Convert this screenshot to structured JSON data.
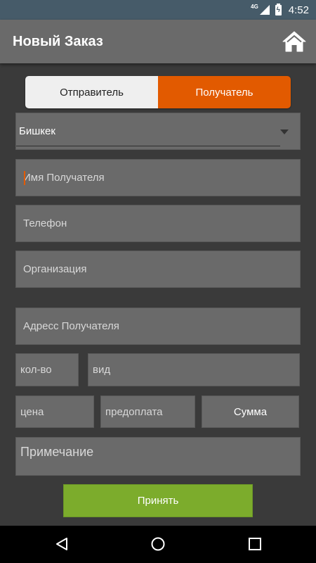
{
  "status_bar": {
    "network": "4G",
    "time": "4:52"
  },
  "app_bar": {
    "title": "Новый Заказ"
  },
  "toggle": {
    "sender_label": "Отправитель",
    "recipient_label": "Получатель",
    "active": "recipient",
    "active_color": "#e25a00"
  },
  "form": {
    "city_value": "Бишкек",
    "recipient_name_placeholder": "Имя Получателя",
    "phone_placeholder": "Телефон",
    "organization_placeholder": "Организация",
    "address_placeholder": "Адресс Получателя",
    "quantity_placeholder": "кол-во",
    "type_placeholder": "вид",
    "price_placeholder": "цена",
    "prepayment_placeholder": "предоплата",
    "sum_button_label": "Сумма",
    "note_placeholder": "Примечание"
  },
  "actions": {
    "accept_label": "Принять",
    "accept_color": "#7cac2c"
  },
  "icons": {
    "home": "home-icon",
    "back": "back-triangle-icon",
    "nav_home": "circle-home-icon",
    "recent": "square-recents-icon"
  }
}
